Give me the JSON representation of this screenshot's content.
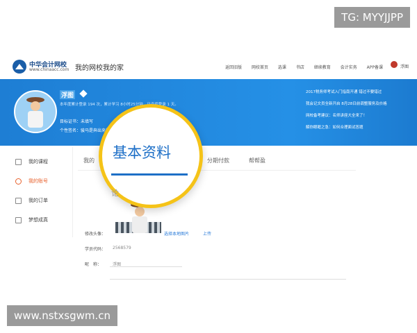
{
  "watermarks": {
    "top": "TG: MYYJJPP",
    "bottom": "www.nstxsgwm.cn"
  },
  "header": {
    "brand": "中华会计网校",
    "brand_url": "www.chinaacc.com",
    "site_title": "我的网校我的家",
    "nav": [
      "返回旧版",
      "网校首页",
      "选课",
      "书店",
      "继续教育",
      "会计实务",
      "APP备课"
    ],
    "username": "浮图"
  },
  "profile": {
    "nickname": "浮图",
    "stats": "本年度累计登录 194 次，累计学习 8小时25分钟，已连续登录 1 天。",
    "goal": "目标证书：未填写",
    "signature": "个性签名：骏马是奔出来的"
  },
  "news": [
    "2017税务师考试入门指南开通 错过不要错过",
    "我会记文员全新开启 8月28日前调整服务及价格",
    "网校备考建议：名师讲座大全来了！",
    "解你眼眶之急：如何合理面试答题"
  ],
  "sidebar": {
    "items": [
      {
        "label": "我的课程",
        "active": false
      },
      {
        "label": "我的账号",
        "active": true
      },
      {
        "label": "我的订单",
        "active": false
      },
      {
        "label": "梦想成真",
        "active": false
      }
    ]
  },
  "tabs": [
    "我的",
    "分期付款",
    "帮帮盈"
  ],
  "magnifier": {
    "title": "基本资料",
    "small": "论"
  },
  "form": {
    "avatar_label": "修改头像：",
    "select_local": "选择本地图片",
    "upload": "上传",
    "student_code_label": "学员代码：",
    "student_code_value": "2568579",
    "nickname_label": "昵　称：",
    "nickname_value": "浮图"
  }
}
